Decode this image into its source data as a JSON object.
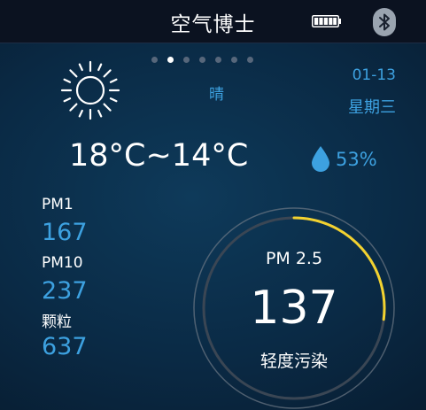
{
  "header": {
    "title": "空气博士",
    "battery_icon": "battery-full-icon",
    "bluetooth_icon": "bluetooth-icon"
  },
  "pager": {
    "total": 7,
    "active": 2
  },
  "weather": {
    "icon": "sun-icon",
    "condition": "晴",
    "date": "01-13",
    "weekday": "星期三",
    "temperature": "18°C~14°C",
    "humidity": "53%",
    "humidity_icon": "water-drop-icon"
  },
  "metrics": [
    {
      "label": "PM1",
      "value": "167"
    },
    {
      "label": "PM10",
      "value": "237"
    },
    {
      "label": "颗粒",
      "value": "637"
    }
  ],
  "gauge": {
    "label": "PM 2.5",
    "value": "137",
    "status": "轻度污染",
    "level_fraction": 0.27
  },
  "colors": {
    "accent": "#3da1e0",
    "gauge_arc": "#f2d230",
    "gauge_track": "#4a5563"
  }
}
